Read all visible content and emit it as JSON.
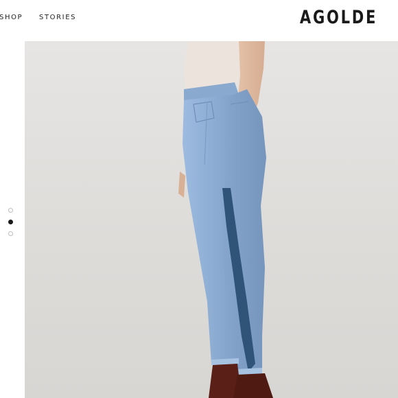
{
  "nav": {
    "items": [
      {
        "label": "SHOP"
      },
      {
        "label": "STORIES"
      }
    ]
  },
  "brand": {
    "logo_text": "AGOLDE"
  },
  "carousel": {
    "slide_count": 3,
    "active_index": 1
  },
  "colors": {
    "background": "#ffffff",
    "hero_background": "#e1dfdc",
    "denim": "#8fb0d6",
    "side_stripe": "#2f5478",
    "boots": "#5a1f16",
    "top": "#ece4dc",
    "skin": "#e2bfa4"
  }
}
